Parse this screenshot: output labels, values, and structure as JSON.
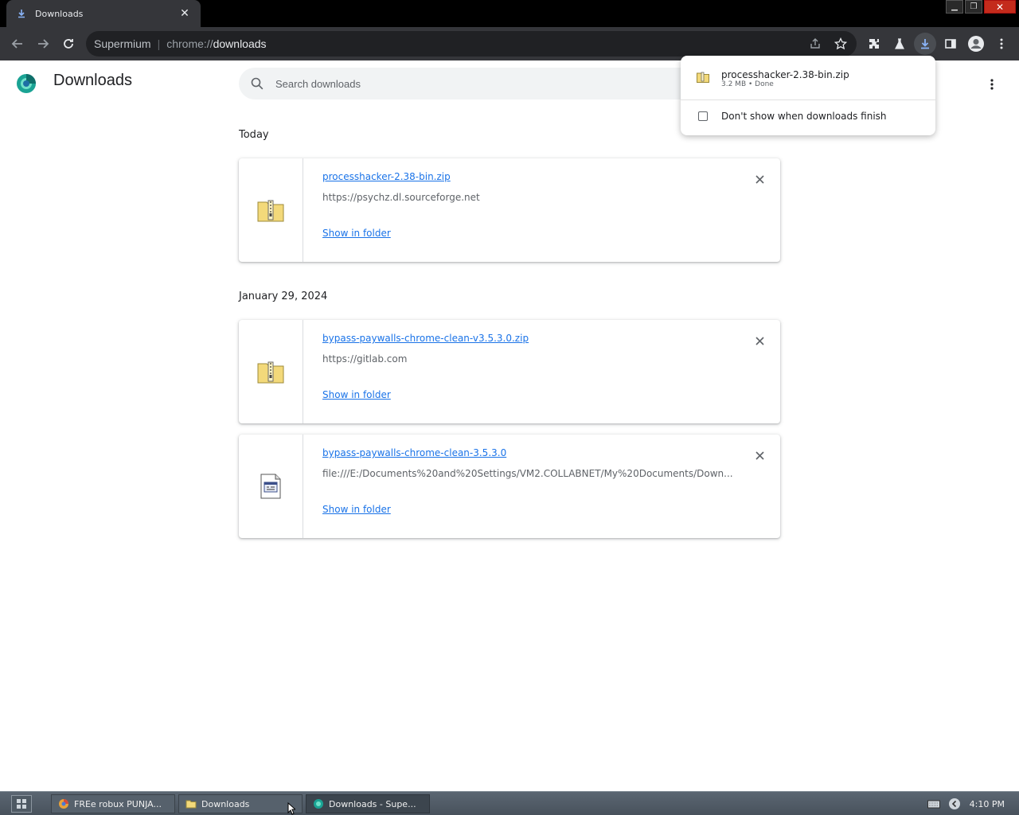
{
  "browser": {
    "tab_title": "Downloads",
    "omnibox": {
      "site_name": "Supermium",
      "separator": "|",
      "url_scheme": "chrome://",
      "url_path": "downloads"
    }
  },
  "page": {
    "title": "Downloads",
    "search_placeholder": "Search downloads"
  },
  "groups": [
    {
      "date": "Today",
      "items": [
        {
          "file_name": "processhacker-2.38-bin.zip",
          "url": "https://psychz.dl.sourceforge.net",
          "action": "Show in folder",
          "icon": "zip-folder-icon"
        }
      ]
    },
    {
      "date": "January 29, 2024",
      "items": [
        {
          "file_name": "bypass-paywalls-chrome-clean-v3.5.3.0.zip",
          "url": "https://gitlab.com",
          "action": "Show in folder",
          "icon": "zip-folder-icon"
        },
        {
          "file_name": "bypass-paywalls-chrome-clean-3.5.3.0",
          "url": "file:///E:/Documents%20and%20Settings/VM2.COLLABNET/My%20Documents/Down...",
          "action": "Show in folder",
          "icon": "generic-file-icon"
        }
      ]
    }
  ],
  "download_bubble": {
    "file_name": "processhacker-2.38-bin.zip",
    "status": "3.2 MB • Done",
    "checkbox_label": "Don't show when downloads finish"
  },
  "taskbar": {
    "tasks": [
      {
        "label": "FREe robux PUNJA...",
        "icon": "browser-icon"
      },
      {
        "label": "Downloads",
        "icon": "folder-icon"
      },
      {
        "label": "Downloads - Supe...",
        "icon": "supermium-icon"
      }
    ],
    "clock": "4:10 PM"
  },
  "colors": {
    "link": "#1a73e8",
    "toolbar": "#35363a",
    "omnibox": "#202124"
  }
}
